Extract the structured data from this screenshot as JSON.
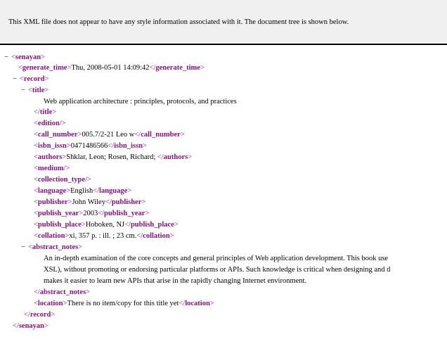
{
  "header": {
    "message": "This XML file does not appear to have any style information associated with it. The document tree is shown below."
  },
  "tree": {
    "toggle_symbol": "−",
    "root_tag": "senayan",
    "generate_time": {
      "tag": "generate_time",
      "value": "Thu, 2008-05-01 14:09:42"
    },
    "record_tag": "record",
    "title": {
      "tag": "title",
      "value": "Web application architecture : principles, protocols, and practices"
    },
    "edition_tag": "edition",
    "call_number": {
      "tag": "call_number",
      "value": "005.7/2-21 Leo w"
    },
    "isbn_issn": {
      "tag": "isbn_issn",
      "value": "0471486566"
    },
    "authors": {
      "tag": "authors",
      "value": "Shklar, Leon; Rosen, Richard; "
    },
    "medium_tag": "medium",
    "collection_type_tag": "collection_type",
    "language": {
      "tag": "language",
      "value": "English"
    },
    "publisher": {
      "tag": "publisher",
      "value": "John Wiley"
    },
    "publish_year": {
      "tag": "publish_year",
      "value": "2003"
    },
    "publish_place": {
      "tag": "publish_place",
      "value": "Hoboken, NJ"
    },
    "collation": {
      "tag": "collation",
      "value": "xi, 357 p. : ill. ; 23 cm."
    },
    "abstract_notes": {
      "tag": "abstract_notes",
      "line1": "An in-depth examination of the core concepts and general principles of Web application development. This book use",
      "line2": "XSL), without promoting or endorsing particular platforms or APIs. Such knowledge is critical when designing and d",
      "line3": "makes it easier to learn new APIs that arise in the rapidly changing Internet environment."
    },
    "location": {
      "tag": "location",
      "value": "There is no item/copy for this title yet"
    }
  }
}
